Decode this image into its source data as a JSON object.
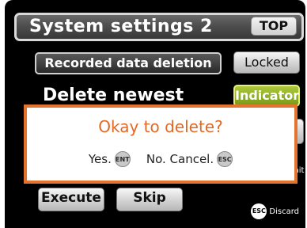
{
  "header": {
    "title": "System settings 2",
    "top_button": "TOP"
  },
  "menu": {
    "recorded_data_deletion": "Recorded data deletion",
    "locked": "Locked",
    "delete_newest_data": "Delete newest data",
    "indicator": "Indicator",
    "side_partial_text": "mit"
  },
  "footer": {
    "execute": "Execute",
    "skip": "Skip",
    "esc_key": "ESC",
    "discard": "Discard"
  },
  "dialog": {
    "title": "Okay to delete?",
    "yes": "Yes.",
    "yes_key": "ENT",
    "no": "No. Cancel.",
    "no_key": "ESC"
  },
  "colors": {
    "dialog_border": "#e4732e",
    "dialog_title": "#e06a25",
    "indicator": "#8aaa24"
  }
}
